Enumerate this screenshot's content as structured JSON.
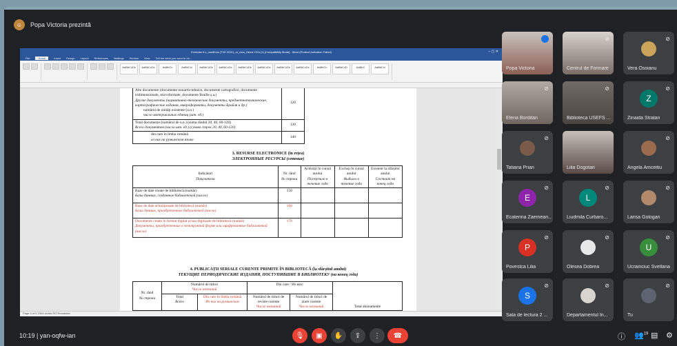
{
  "presenter": {
    "name": "Popa Victoria prezintă"
  },
  "word": {
    "title": "Formular 6 c_modif.ica (TVE 2021)_ro_rezs_Heme CEA (1) [Compatibility Mode] - Word (Product Activation Failed)",
    "tabs": [
      "File",
      "Home",
      "Insert",
      "Design",
      "Layout",
      "References",
      "Mailings",
      "Review",
      "View",
      "Tell me what you want to do..."
    ],
    "styles": [
      "AaBbCcDc",
      "AaBbCcDc",
      "AaBbCc",
      "AaBbCcI",
      "AaBbCcDc",
      "AaBbCcDc",
      "AaBbCcDc",
      "AaBbCcDc",
      "AaBbCcDc",
      "AaBbCcDc",
      "AaBbCc",
      "AaBbCcD",
      "AaBbC",
      "AaBbCcl"
    ],
    "status": "Page 4 of 6   2304 words   RO   Romanian"
  },
  "document": {
    "rows_top": [
      {
        "text": "Alte documente (documente nonartis-tehnice, documente cartografice, documente tridimensionale, microformate, documente Braille ș.a.)",
        "text_ru": "Другие документы (нормативно-технические документы, предметнотехнические, картографические издания, микроформаты, документы Брайля и др.)",
        "sub": "numărul de unități existente (u.n.)",
        "sub_ru": "число материальных единиц (шт. ед.)",
        "code": "120"
      },
      {
        "text": "Total documente (numărul de u.n.) (suma rândul 20, 40, 60-120)",
        "text_ru": "Всего документов (число шт. ед.) (сумма строк 20, 40, 60-120)",
        "code": "130"
      },
      {
        "text": "din care în limba română",
        "text_ru": "из них на румынском языке",
        "code": "140"
      }
    ],
    "section3_title": "3. RESURSE ELECTRONICE (în rețea)",
    "section3_title_ru": "ЭЛЕКТРОННЫЕ РЕСУРСЫ (сетевые)",
    "headers": {
      "indicator": "Indicatori",
      "indicator_ru": "Показатели",
      "nr": "Nr. rând",
      "nr_ru": "№ строки",
      "acq": "Achiziții în cursul anului",
      "acq_ru": "Поступило в течение года",
      "exc": "Excluși în cursul anului",
      "exc_ru": "Выбыло в течение года",
      "exist": "Existent la sfârșitul anului",
      "exist_ru": "Состоит на конец года"
    },
    "rows_res": [
      {
        "text": "Baze de date create de bibliotecă (număr)",
        "text_ru": "Базы данных, созданные библиотекой (число)",
        "code": "150",
        "red": false
      },
      {
        "text": "Baze de date achiziționate de bibliotecă (număr)",
        "text_ru": "Базы данных, приобретенные библиотекой (число)",
        "code": "160",
        "red": true
      },
      {
        "text": "Documente create în format digital și/sau digitizate de bibliotecă (număr)",
        "text_ru": "Документы, приобретенные в электронной форме или оцифрованные библиотекой (число)",
        "code": "170",
        "red": true
      }
    ],
    "section4_title": "4. PUBLICAȚII SERIALE CURENTE PRIMITE ÎN BIBLIOTECĂ (la sfârșitul anului)",
    "section4_title_ru": "ТЕКУЩИЕ ПЕРИОДИЧЕСКИЕ ИЗДАНИЯ, ПОСТУПИВШИЕ В БИБЛИОТЕКУ (на конец года)",
    "s4": {
      "num_titles": "Numărul de titluri",
      "num_titles_ru": "Число названий",
      "of_which": "Din care / Из них:",
      "nr": "Nr. rând",
      "nr_ru": "№ строки",
      "total": "Total",
      "total_ru": "Всего",
      "ro": "Din care în limba română",
      "ro_ru": "Из них на румынском",
      "rev": "Numărul de titluri de reviste curente",
      "rev_ru": "Число названий",
      "ziare": "Numărul de titluri de ziare curente",
      "ziare_ru": "Число названий",
      "abon": "Total abonamente"
    }
  },
  "participants": [
    {
      "name": "Popa Victoria",
      "kind": "video"
    },
    {
      "name": "Centrul de Formare",
      "kind": "video"
    },
    {
      "name": "Vera Osoianu",
      "kind": "photo"
    },
    {
      "name": "Elena Borditan",
      "kind": "video"
    },
    {
      "name": "Biblioteca USEFS ...",
      "kind": "video"
    },
    {
      "name": "Zinaida Stratan",
      "kind": "letter",
      "letter": "Z",
      "color": "#00796b"
    },
    {
      "name": "Tatiana Prian",
      "kind": "photo"
    },
    {
      "name": "Lilia Dogotari",
      "kind": "video"
    },
    {
      "name": "Angela Amceitiu",
      "kind": "photo"
    },
    {
      "name": "Ecaterina Zaemean...",
      "kind": "letter",
      "letter": "E",
      "color": "#8e24aa"
    },
    {
      "name": "Liudmila Curbaro...",
      "kind": "letter",
      "letter": "L",
      "color": "#00897b"
    },
    {
      "name": "Larisa Gologan",
      "kind": "photo"
    },
    {
      "name": "Povestca Lilia",
      "kind": "letter",
      "letter": "P",
      "color": "#d93025"
    },
    {
      "name": "Olesea Dobrea",
      "kind": "photo"
    },
    {
      "name": "Ucrainciuc Svetlana",
      "kind": "letter",
      "letter": "U",
      "color": "#388e3c"
    },
    {
      "name": "Sala de lectura 2 ...",
      "kind": "letter",
      "letter": "S",
      "color": "#1a73e8"
    },
    {
      "name": "Departamentul In...",
      "kind": "photo"
    },
    {
      "name": "Tu",
      "kind": "photo"
    }
  ],
  "bottom": {
    "meeting": "10:19  |  yan-oqfw-ian",
    "people_count": "19"
  }
}
